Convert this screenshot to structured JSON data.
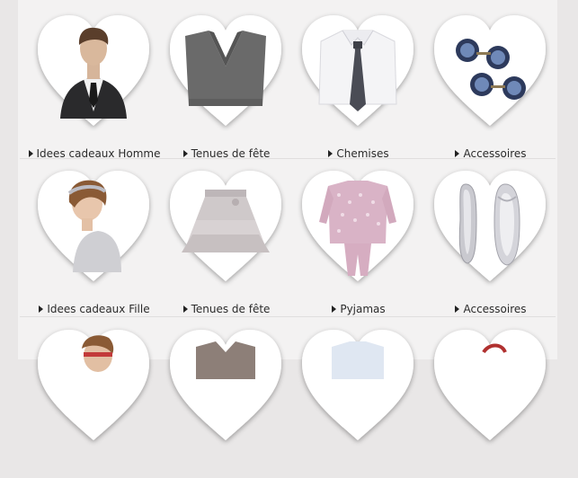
{
  "categories": {
    "row1": [
      {
        "label": "Idees cadeaux Homme",
        "icon": "man-in-suit-image"
      },
      {
        "label": "Tenues de fête",
        "icon": "grey-vneck-sweater-image"
      },
      {
        "label": "Chemises",
        "icon": "white-shirt-tie-image"
      },
      {
        "label": "Accessoires",
        "icon": "cufflinks-image"
      }
    ],
    "row2": [
      {
        "label": "Idees cadeaux Fille",
        "icon": "girl-headband-image"
      },
      {
        "label": "Tenues de fête",
        "icon": "grey-tiered-skirt-image"
      },
      {
        "label": "Pyjamas",
        "icon": "pink-pyjamas-image"
      },
      {
        "label": "Accessoires",
        "icon": "silver-ballet-shoes-image"
      }
    ]
  },
  "colors": {
    "heart_fill": "#ffffff",
    "heart_shadow": "#d6d3d3",
    "page_background": "#e9e7e7",
    "panel_background": "#f3f2f2",
    "label_text": "#2b2b2b"
  }
}
